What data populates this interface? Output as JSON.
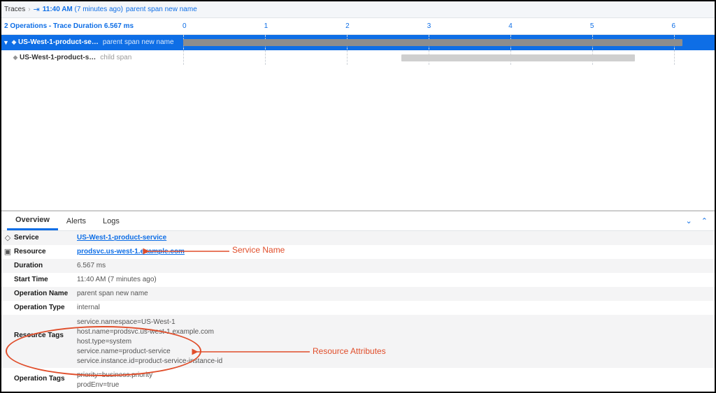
{
  "breadcrumb": {
    "root": "Traces",
    "time": "11:40 AM",
    "ago": "(7 minutes ago)",
    "name": "parent span new name"
  },
  "trace": {
    "stats": "2 Operations - Trace Duration 6.567 ms",
    "axis": [
      "0",
      "1",
      "2",
      "3",
      "4",
      "5",
      "6"
    ]
  },
  "spans": [
    {
      "service": "US-West-1-product-se…",
      "op": "parent span new name",
      "selected": true,
      "bar": {
        "left": 0,
        "width": 100,
        "cls": "bar1"
      }
    },
    {
      "service": "US-West-1-product-s…",
      "op": "child span",
      "selected": false,
      "bar": {
        "left": 43.5,
        "width": 47,
        "cls": "bar2"
      }
    }
  ],
  "tabs": {
    "t0": "Overview",
    "t1": "Alerts",
    "t2": "Logs"
  },
  "attrs": {
    "service_key": "Service",
    "service_val": "US-West-1-product-service",
    "resource_key": "Resource",
    "resource_val": "prodsvc.us-west-1.example.com",
    "duration_key": "Duration",
    "duration_val": "6.567 ms",
    "start_key": "Start Time",
    "start_val": "11:40 AM  (7 minutes ago)",
    "opname_key": "Operation Name",
    "opname_val": "parent span new name",
    "optype_key": "Operation Type",
    "optype_val": "internal",
    "rtags_key": "Resource Tags",
    "rtags": [
      "service.namespace=US-West-1",
      "host.name=prodsvc.us-west-1.example.com",
      "host.type=system",
      "service.name=product-service",
      "service.instance.id=product-service-instance-id"
    ],
    "otags_key": "Operation Tags",
    "otags": [
      "priority=business.priority",
      "prodEnv=true"
    ]
  },
  "annotations": {
    "svc": "Service Name",
    "res": "Resource Attributes"
  }
}
